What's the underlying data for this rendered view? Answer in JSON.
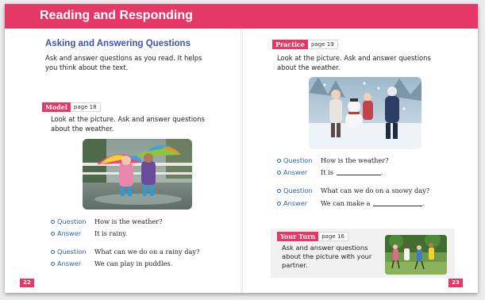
{
  "header": {
    "title": "Reading and Responding"
  },
  "left_page": {
    "page_number": "22",
    "heading": "Asking and Answering Questions",
    "intro": "Ask and answer questions as you read. It helps you think about the text.",
    "model": {
      "label": "Model",
      "page_ref": "page 18",
      "instruction": "Look at the picture. Ask and answer questions about the weather.",
      "qa": [
        {
          "label": "Question",
          "text": "How is the weather?"
        },
        {
          "label": "Answer",
          "text": "It is rainy."
        },
        {
          "label": "Question",
          "text": "What can we do on a rainy day?"
        },
        {
          "label": "Answer",
          "text": "We can play in puddles."
        }
      ]
    }
  },
  "right_page": {
    "page_number": "23",
    "practice": {
      "label": "Practice",
      "page_ref": "page 19",
      "instruction": "Look at the picture. Ask and answer questions about the weather.",
      "qa": [
        {
          "label": "Question",
          "text": "How is the weather?"
        },
        {
          "label": "Answer",
          "text": "It is",
          "suffix": "."
        },
        {
          "label": "Question",
          "text": "What can we do on a snowy day?"
        },
        {
          "label": "Answer",
          "text": "We can make a",
          "suffix": "."
        }
      ]
    },
    "your_turn": {
      "label": "Your Turn",
      "page_ref": "page 16",
      "text": "Ask and answer questions about the picture with your partner."
    }
  },
  "colors": {
    "accent": "#e53866",
    "heading_blue": "#3d55a8",
    "qa_blue": "#2e63a8"
  }
}
